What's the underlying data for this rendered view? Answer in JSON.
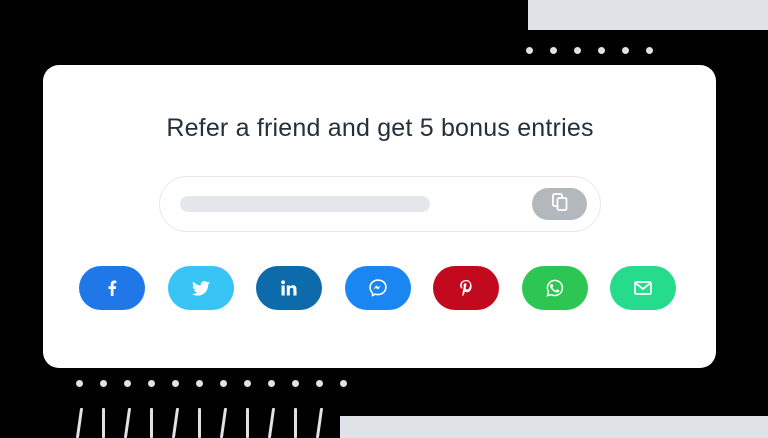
{
  "headline": "Refer a friend and get 5 bonus entries",
  "referral_link": {
    "value": "",
    "copy_icon": "copy-icon"
  },
  "share_buttons": [
    {
      "network": "facebook",
      "icon": "facebook-icon",
      "color": "#1f77e8"
    },
    {
      "network": "twitter",
      "icon": "twitter-icon",
      "color": "#38c4f5"
    },
    {
      "network": "linkedin",
      "icon": "linkedin-icon",
      "color": "#0d6bab"
    },
    {
      "network": "messenger",
      "icon": "messenger-icon",
      "color": "#1a86f2"
    },
    {
      "network": "pinterest",
      "icon": "pinterest-icon",
      "color": "#c2091d"
    },
    {
      "network": "whatsapp",
      "icon": "whatsapp-icon",
      "color": "#2dc653"
    },
    {
      "network": "email",
      "icon": "email-icon",
      "color": "#27db8c"
    }
  ],
  "colors": {
    "card_background": "#ffffff",
    "page_background": "#000000",
    "decoration": "#dfe2e6",
    "copy_button": "#b3b8bd",
    "headline_text": "#24303a"
  }
}
